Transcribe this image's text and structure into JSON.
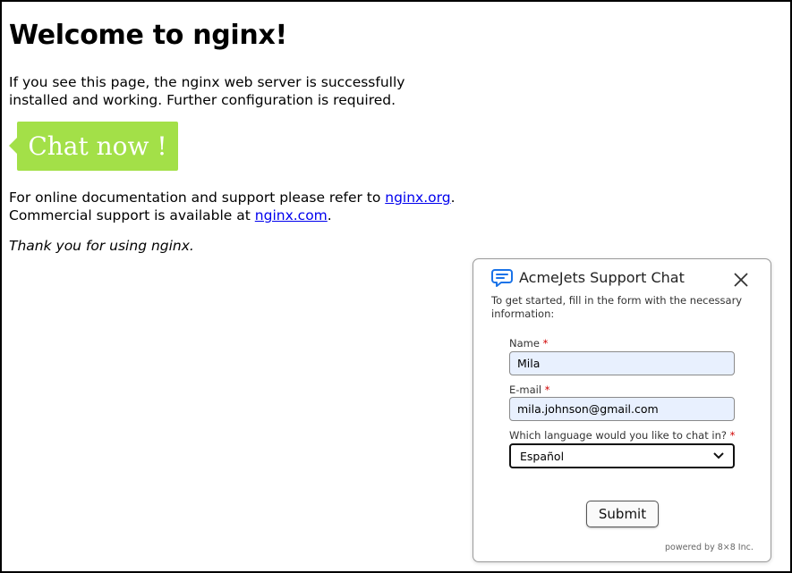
{
  "page": {
    "heading": "Welcome to nginx!",
    "intro": "If you see this page, the nginx web server is successfully installed and working. Further configuration is required.",
    "chat_button": "Chat now !",
    "docs_prefix": "For online documentation and support please refer to ",
    "docs_link": "nginx.org",
    "docs_suffix": ".",
    "commercial_prefix": "Commercial support is available at ",
    "commercial_link": "nginx.com",
    "commercial_suffix": ".",
    "thanks": "Thank you for using nginx."
  },
  "chat_widget": {
    "title": "AcmeJets Support Chat",
    "intro": "To get started, fill in the form with the necessary information:",
    "name_label": "Name",
    "name_value": "Mila",
    "email_label": "E-mail",
    "email_value": "mila.johnson@gmail.com",
    "language_label": "Which language would you like to chat in?",
    "language_value": "Español",
    "required_mark": "*",
    "submit_label": "Submit",
    "powered_by": "powered by 8×8 Inc.",
    "icons": {
      "chat": "chat-bubble-icon",
      "close": "close-icon",
      "dropdown": "chevron-down-icon"
    },
    "colors": {
      "accent_icon": "#1a73e8",
      "required": "#d00000",
      "input_bg": "#e8f0fe"
    }
  },
  "colors": {
    "chat_button_bg": "#a3e048",
    "link": "#0000ee"
  }
}
